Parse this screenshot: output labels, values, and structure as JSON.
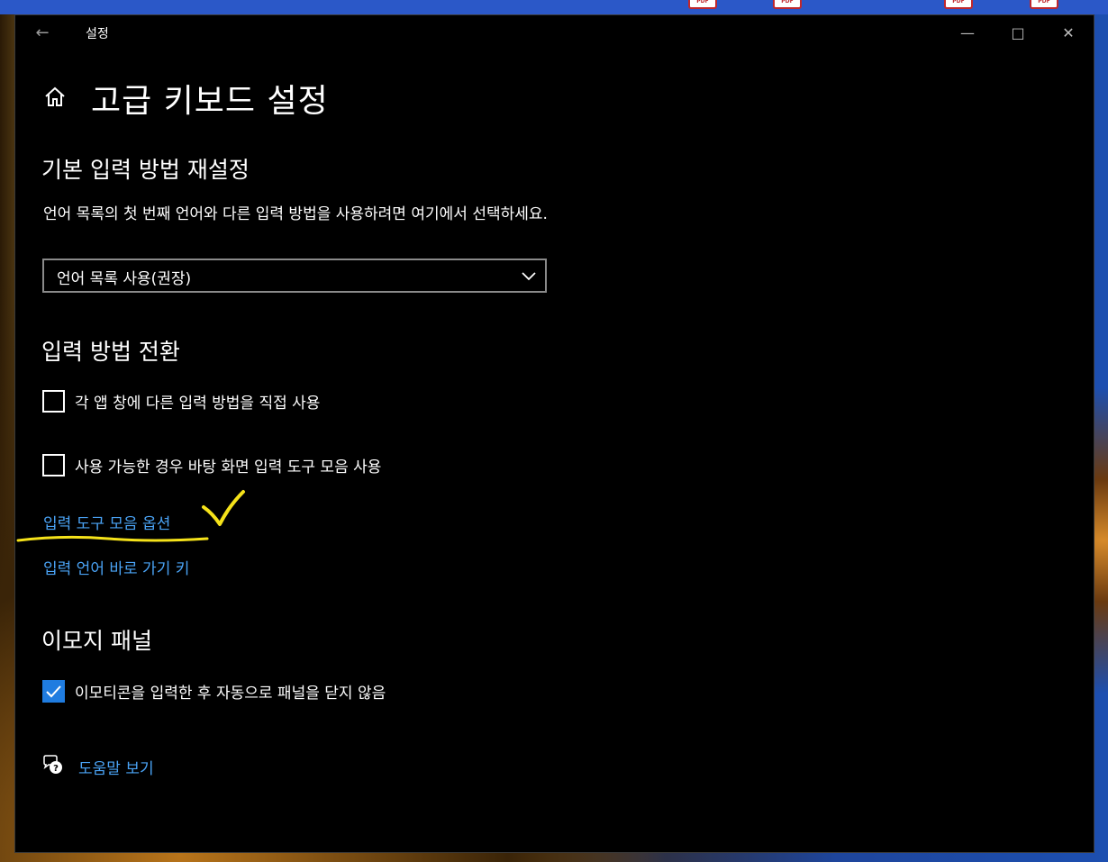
{
  "window": {
    "title": "설정",
    "back_icon": "back-arrow-icon",
    "controls": [
      "minimize-icon",
      "maximize-icon",
      "close-icon"
    ]
  },
  "page": {
    "title": "고급 키보드 설정",
    "home_icon": "home-icon"
  },
  "default_input": {
    "heading": "기본 입력 방법 재설정",
    "description": "언어 목록의 첫 번째 언어와 다른 입력 방법을 사용하려면 여기에서 선택하세요.",
    "dropdown_value": "언어 목록 사용(권장)"
  },
  "switching": {
    "heading": "입력 방법 전환",
    "options": [
      {
        "label": "각 앱 창에 다른 입력 방법을 직접 사용",
        "checked": false
      },
      {
        "label": "사용 가능한 경우 바탕 화면 입력 도구 모음 사용",
        "checked": false
      }
    ],
    "links": [
      "입력 도구 모음 옵션",
      "입력 언어 바로 가기 키"
    ]
  },
  "emoji": {
    "heading": "이모지 패널",
    "options": [
      {
        "label": "이모티콘을 입력한 후 자동으로 패널을 닫지 않음",
        "checked": true
      }
    ]
  },
  "help": {
    "label": "도움말 보기",
    "icon": "help-chat-icon"
  },
  "colors": {
    "background": "#000000",
    "text": "#ffffff",
    "link": "#4aa3f5",
    "checkbox_checked": "#1f7ce0",
    "annotation": "#f5e21a"
  }
}
